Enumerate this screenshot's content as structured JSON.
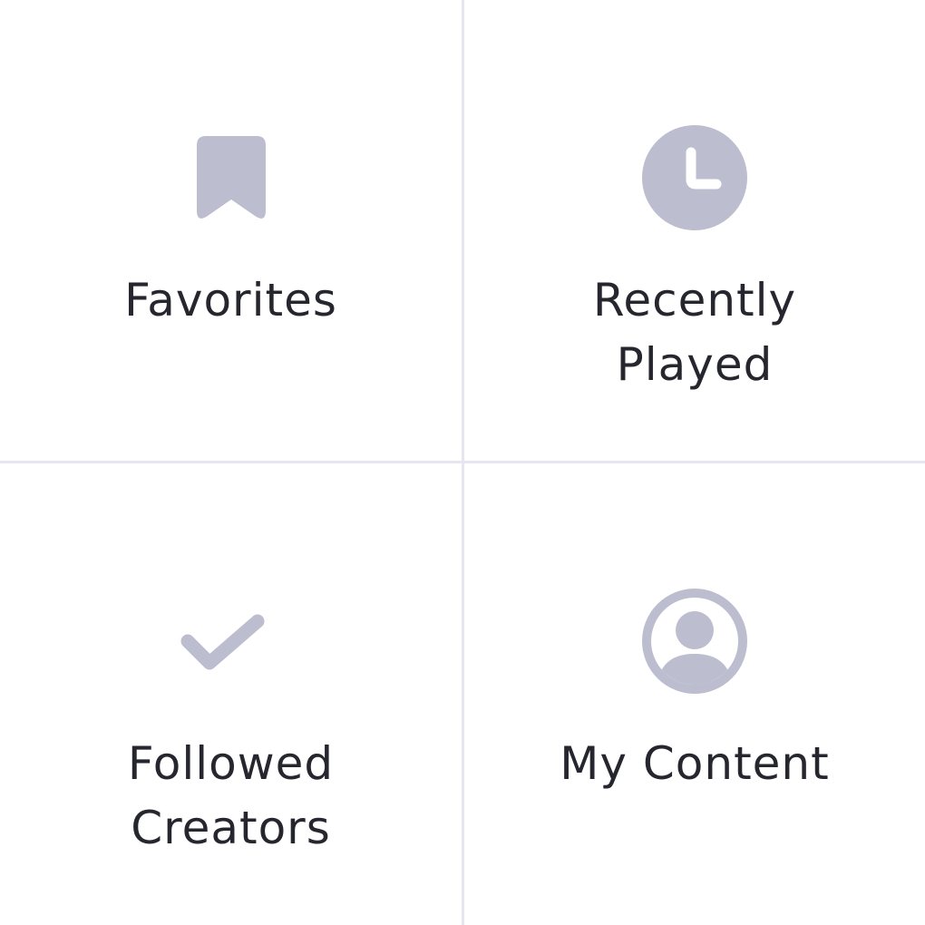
{
  "tiles": [
    {
      "label_lines": [
        "Favorites"
      ],
      "icon": "bookmark-icon"
    },
    {
      "label_lines": [
        "Recently",
        "Played"
      ],
      "icon": "clock-icon"
    },
    {
      "label_lines": [
        "Followed",
        "Creators"
      ],
      "icon": "checkmark-icon"
    },
    {
      "label_lines": [
        "My Content"
      ],
      "icon": "user-circle-icon"
    }
  ],
  "colors": {
    "icon": "#bcbdcf",
    "text": "#26262e",
    "divider": "#e6e5f0",
    "background": "#ffffff"
  }
}
